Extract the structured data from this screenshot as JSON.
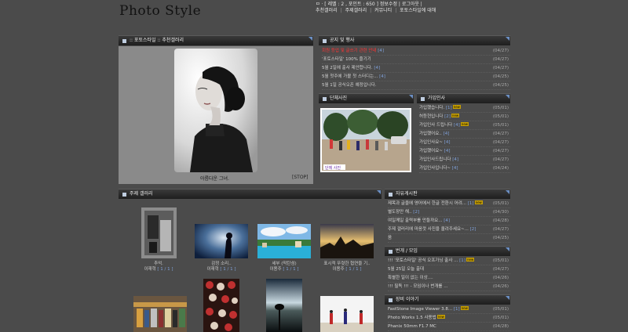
{
  "site": {
    "logo": "Photo Style"
  },
  "top": {
    "line1": "ㅁ · [ 레벨 : 2 , 포인트 : 650 ] 정보수정 | 로그아웃 |",
    "links": [
      "추천갤러리",
      "주제갤러리",
      "커뮤니티",
      "포토스타일에 대해"
    ]
  },
  "gallery": {
    "title": ":: 포토스타일 :: 추천갤러리",
    "caption": "아름다운 그녀.",
    "stop": "[STOP]"
  },
  "notices": {
    "title": "공지 및 행사",
    "items": [
      {
        "text": "회원 등업 및 글쓰기 관련 안내",
        "count": "[4]",
        "date": "(04/27)",
        "red": true
      },
      {
        "text": "'포토스타일' 100% 즐기기",
        "count": "",
        "date": "(04/27)"
      },
      {
        "text": "5월 2일에 출사 제안합니다.",
        "count": "[4]",
        "date": "(04/27)"
      },
      {
        "text": "5월 첫주에 가볼 첫 스터디는...",
        "count": "[4]",
        "date": "(04/25)"
      },
      {
        "text": "5월 1일 공식오픈 예정입니다.",
        "count": "",
        "date": "(04/25)"
      }
    ]
  },
  "spotlight": {
    "title": "단체사진",
    "photo_label": "단체 사진"
  },
  "greetings": {
    "title": "가입인사",
    "items": [
      {
        "text": "가입했습니다.",
        "count": "[1]",
        "new": true,
        "date": "(05/01)"
      },
      {
        "text": "허등현입니다",
        "count": "[2]",
        "new": true,
        "date": "(05/01)"
      },
      {
        "text": "가입인사 드립니다",
        "count": "[4]",
        "new": true,
        "date": "(05/01)"
      },
      {
        "text": "가입했어요..",
        "count": "[4]",
        "new": false,
        "date": "(04/27)"
      },
      {
        "text": "가입인사요~",
        "count": "[4]",
        "new": false,
        "date": "(04/27)"
      },
      {
        "text": "가입했어요~",
        "count": "[4]",
        "new": false,
        "date": "(04/27)"
      },
      {
        "text": "가입인사드립니다",
        "count": "[4]",
        "new": false,
        "date": "(04/27)"
      },
      {
        "text": "가입인사입니다~",
        "count": "[4]",
        "new": false,
        "date": "(04/24)"
      }
    ]
  },
  "theme": {
    "title": "주제 갤러리",
    "items": [
      {
        "title": "추억.",
        "author": "이재혁",
        "count": "[ 1 / 1 ]"
      },
      {
        "title": "감정 소리..",
        "author": "이재혁",
        "count": "[ 1 / 1 ]"
      },
      {
        "title": "세부 (막탄섬)",
        "author": "이용주",
        "count": "[ 1 / 1 ]"
      },
      {
        "title": "표시적 뚜렷한 협연을 기..",
        "author": "이용주",
        "count": "[ 1 / 1 ]"
      }
    ]
  },
  "free": {
    "title": "자유게시판",
    "items": [
      {
        "text": "제목과 글을에 영어에서 한글 전환시 어려...",
        "count": "[1]",
        "new": true,
        "date": "(05/01)"
      },
      {
        "text": "별도장만 해..",
        "count": "[2]",
        "new": false,
        "date": "(04/30)"
      },
      {
        "text": "여일께일 출력부를 만들까요...",
        "count": "[4]",
        "new": false,
        "date": "(04/28)"
      },
      {
        "text": "주제 갤러리에 마음껏 사진을 올려주세요~...",
        "count": "[2]",
        "new": false,
        "date": "(04/27)"
      },
      {
        "text": "음",
        "count": "",
        "new": false,
        "date": "(04/25)"
      }
    ]
  },
  "meetup": {
    "title": "번개 / 모임",
    "items": [
      {
        "text": "!!! '포토스타일' 공식 오프가닝 출사 ...",
        "count": "[1]",
        "new": true,
        "date": "(05/01)"
      },
      {
        "text": "5월 25일 오늘 출대",
        "count": "",
        "new": false,
        "date": "(04/27)"
      },
      {
        "text": "특별한 일이 없는 이상....",
        "count": "",
        "new": false,
        "date": "(04/26)"
      },
      {
        "text": "!!! 필독 !!! - 모임이나 번개를 ...",
        "count": "",
        "new": false,
        "date": "(04/26)"
      }
    ]
  },
  "gear": {
    "title": "장비 이야기",
    "items": [
      {
        "text": "FastStone Image Viewer 3.8...",
        "count": "[1]",
        "new": true,
        "date": "(05/01)"
      },
      {
        "text": "Photo Works 1.5 사용법",
        "count": "",
        "new": true,
        "date": "(05/01)"
      },
      {
        "text": "Phanix 50mm F1.7 MC",
        "count": "",
        "new": false,
        "date": "(04/28)"
      }
    ]
  }
}
